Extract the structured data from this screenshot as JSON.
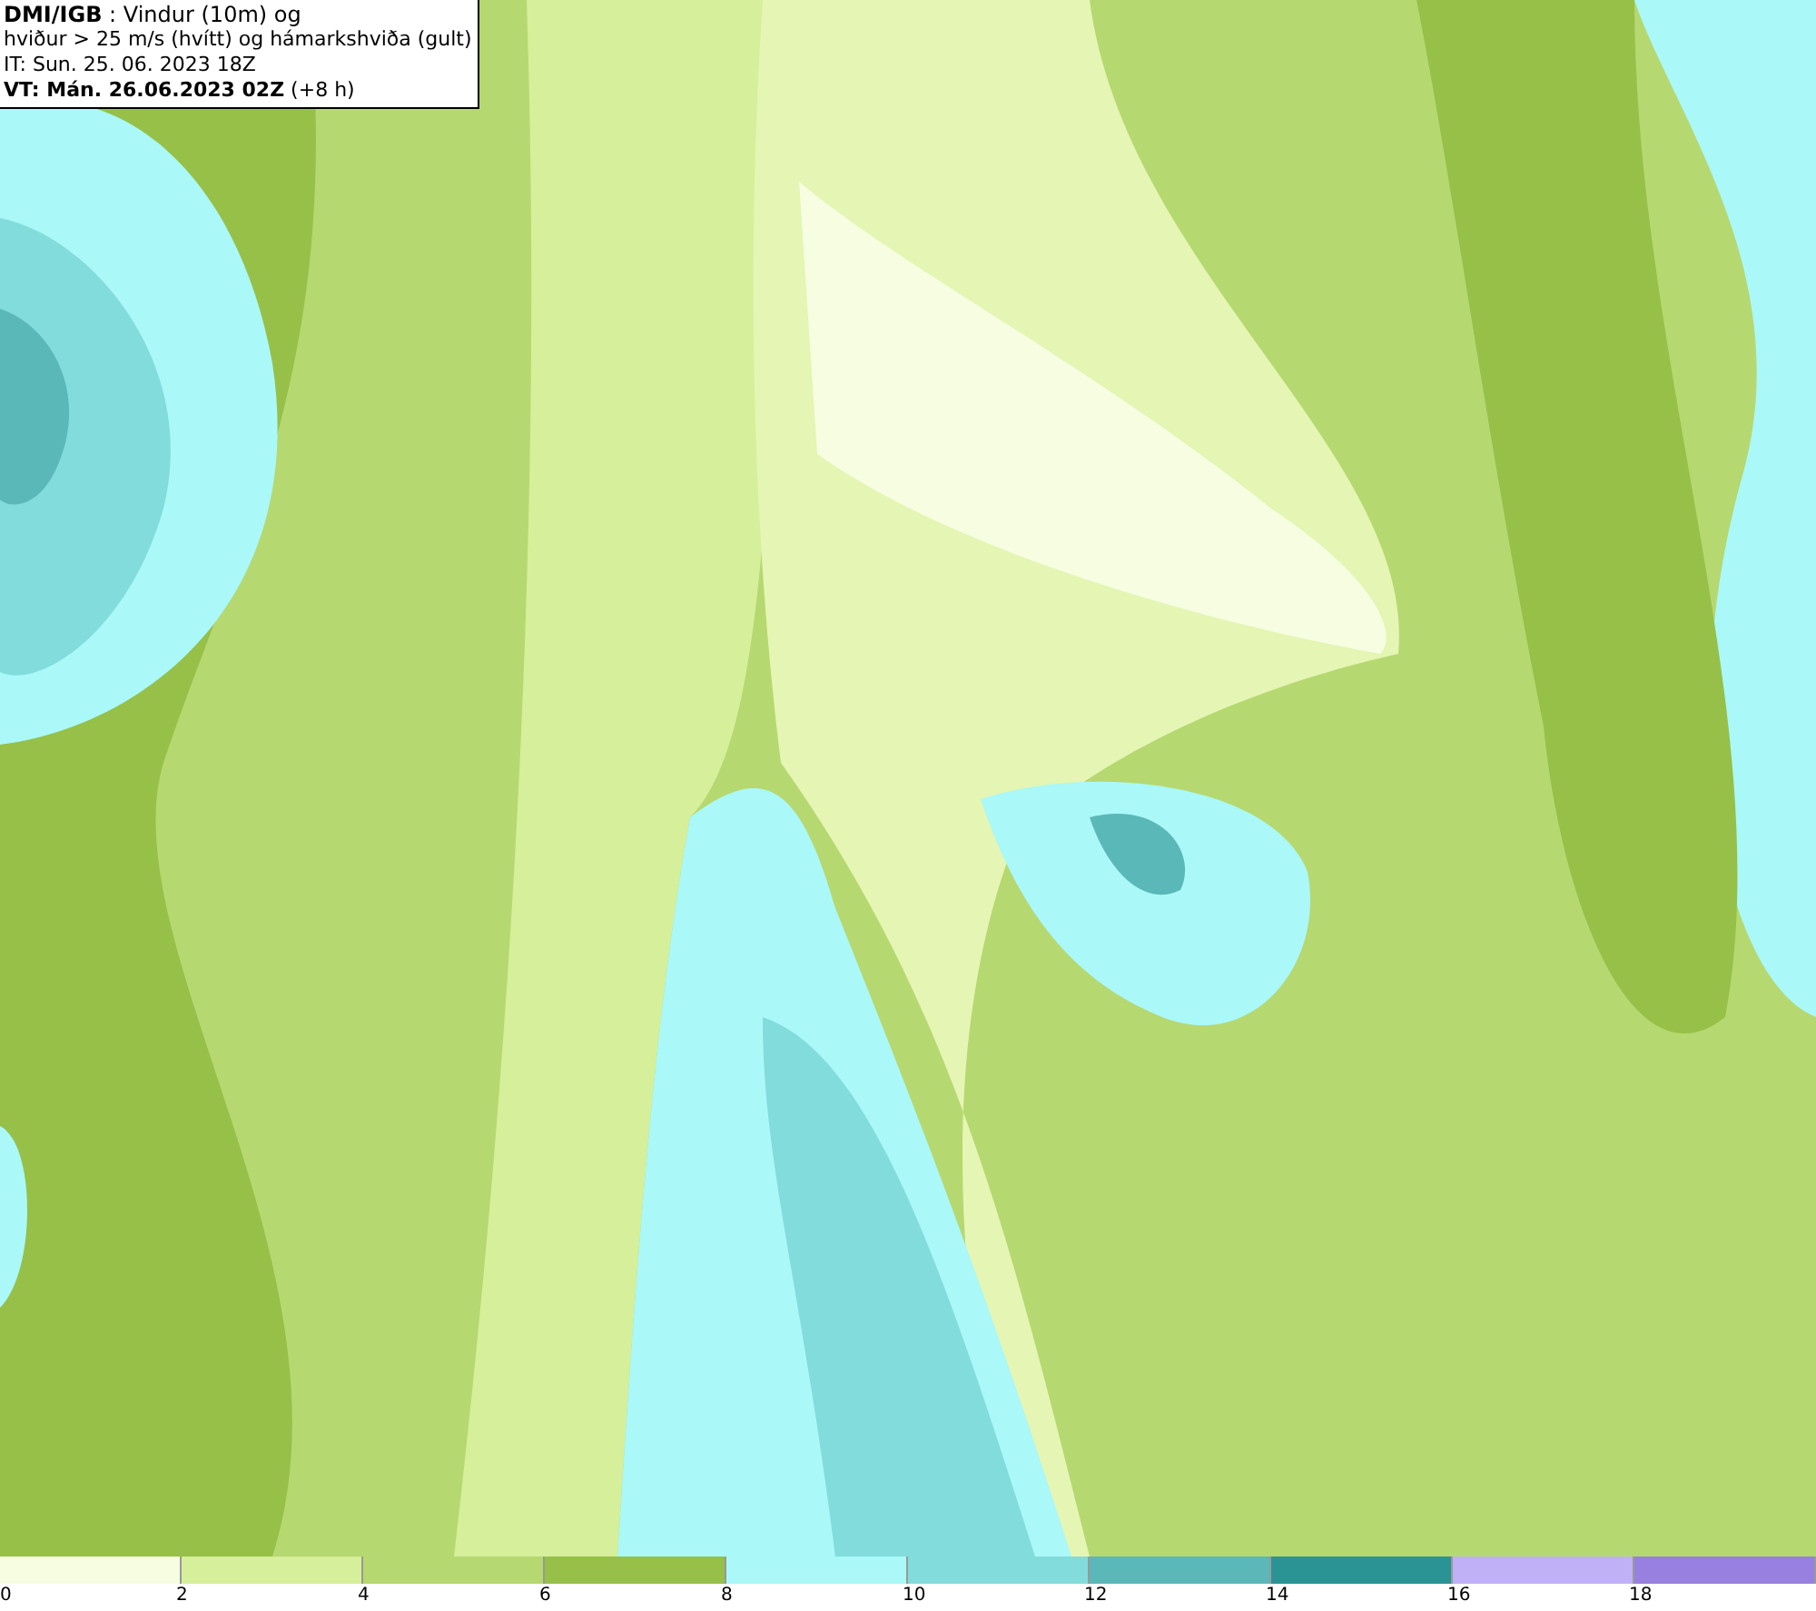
{
  "title_box": {
    "lines": [
      "**DMI/IGB** : Vindur (10m) og",
      "hviður > 25 m/s (hvítt) og hámarkshviða (gult)",
      "IT: Sun. 25. 06. 2023 18Z",
      "**VT: Mán. 26.06.2023 02Z** (+8 h)"
    ]
  },
  "legend": [
    {
      "label": "0",
      "color": "#f6fde0"
    },
    {
      "label": "2",
      "color": "#d6ef9a"
    },
    {
      "label": "4",
      "color": "#b6d870"
    },
    {
      "label": "6",
      "color": "#96c048"
    },
    {
      "label": "8",
      "color": "#aaf8f8"
    },
    {
      "label": "10",
      "color": "#82dcdc"
    },
    {
      "label": "12",
      "color": "#5ab8b8"
    },
    {
      "label": "14",
      "color": "#2a9494"
    },
    {
      "label": "16",
      "color": "#c0b0f8"
    },
    {
      "label": "18",
      "color": "#9880e0"
    }
  ]
}
